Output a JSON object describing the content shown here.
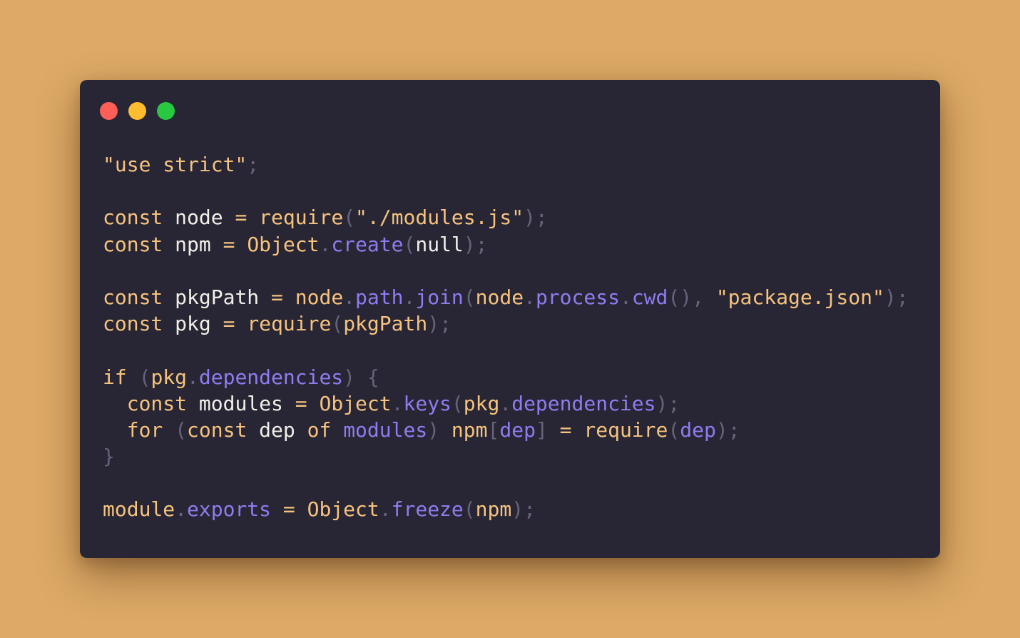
{
  "window": {
    "controls": {
      "close_color": "#ff5f57",
      "minimize_color": "#febc2e",
      "maximize_color": "#28c840"
    }
  },
  "colors": {
    "background": "#dda966",
    "editor_background": "#282634",
    "keyword": "#f6c37f",
    "identifier": "#f2efe9",
    "property": "#8f7cf0",
    "punctuation": "#66647a"
  },
  "code": {
    "language": "javascript",
    "lines": [
      "\"use strict\";",
      "",
      "const node = require(\"./modules.js\");",
      "const npm = Object.create(null);",
      "",
      "const pkgPath = node.path.join(node.process.cwd(), \"package.json\");",
      "const pkg = require(pkgPath);",
      "",
      "if (pkg.dependencies) {",
      "  const modules = Object.keys(pkg.dependencies);",
      "  for (const dep of modules) npm[dep] = require(dep);",
      "}",
      "",
      "module.exports = Object.freeze(npm);"
    ],
    "tokens": {
      "l1": {
        "str": "\"use strict\"",
        "semi": ";"
      },
      "l3": {
        "kw": "const",
        "id": "node",
        "eq": "=",
        "fn": "require",
        "open": "(",
        "str": "\"./modules.js\"",
        "close": ")",
        "semi": ";"
      },
      "l4": {
        "kw": "const",
        "id": "npm",
        "eq": "=",
        "obj": "Object",
        "dot": ".",
        "method": "create",
        "open": "(",
        "arg": "null",
        "close": ")",
        "semi": ";"
      },
      "l6": {
        "kw": "const",
        "id": "pkgPath",
        "eq": "=",
        "obj": "node",
        "dot1": ".",
        "p1": "path",
        "dot2": ".",
        "p2": "join",
        "open": "(",
        "obj2": "node",
        "dot3": ".",
        "p3": "process",
        "dot4": ".",
        "p4": "cwd",
        "call": "()",
        "comma": ",",
        "str": "\"package.json\"",
        "close": ")",
        "semi": ";"
      },
      "l7": {
        "kw": "const",
        "id": "pkg",
        "eq": "=",
        "fn": "require",
        "open": "(",
        "arg": "pkgPath",
        "close": ")",
        "semi": ";"
      },
      "l9": {
        "kw": "if",
        "open": "(",
        "obj": "pkg",
        "dot": ".",
        "prop": "dependencies",
        "close": ")",
        "brace": "{"
      },
      "l10": {
        "indent": "  ",
        "kw": "const",
        "id": "modules",
        "eq": "=",
        "obj": "Object",
        "dot1": ".",
        "method": "keys",
        "open": "(",
        "arg": "pkg",
        "dot2": ".",
        "prop": "dependencies",
        "close": ")",
        "semi": ";"
      },
      "l11": {
        "indent": "  ",
        "kw": "for",
        "open": "(",
        "kw2": "const",
        "id": "dep",
        "kw3": "of",
        "prop": "modules",
        "close": ")",
        "obj": "npm",
        "bopen": "[",
        "key": "dep",
        "bclose": "]",
        "eq": "=",
        "fn": "require",
        "open2": "(",
        "arg": "dep",
        "close2": ")",
        "semi": ";"
      },
      "l12": {
        "brace": "}"
      },
      "l14": {
        "obj": "module",
        "dot1": ".",
        "prop": "exports",
        "eq": "=",
        "obj2": "Object",
        "dot2": ".",
        "method": "freeze",
        "open": "(",
        "arg": "npm",
        "close": ")",
        "semi": ";"
      }
    }
  }
}
